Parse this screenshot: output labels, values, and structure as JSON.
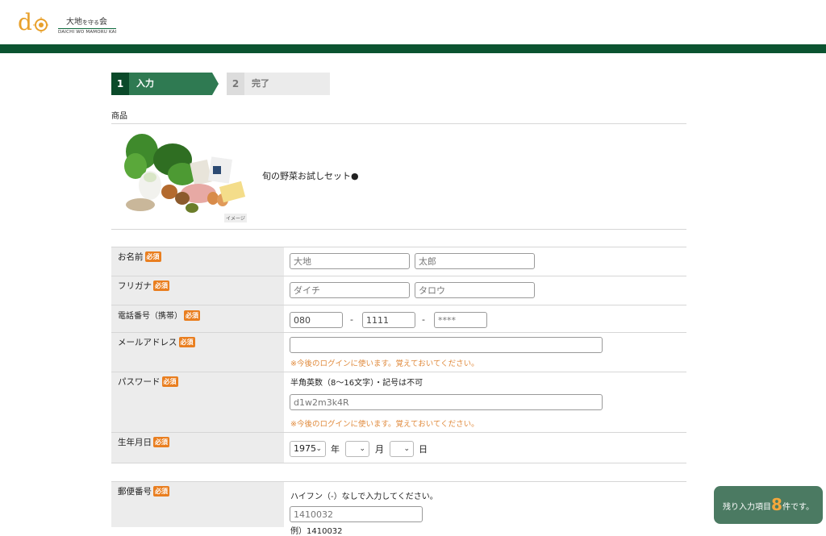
{
  "header": {
    "logo_mark": "do",
    "logo_title": "大地",
    "logo_title_small": "を守る",
    "logo_title_end": "会",
    "logo_subtitle": "DAICHI WO MAMORU KAI",
    "colors": {
      "bar": "#0b5330",
      "brand": "#e8a02b"
    }
  },
  "steps": [
    {
      "num": "1",
      "label": "入力"
    },
    {
      "num": "2",
      "label": "完了"
    }
  ],
  "product": {
    "section_label": "商品",
    "image_note": "イメージ",
    "name": "旬の野菜お試しセット●"
  },
  "form": {
    "required_badge": "必須",
    "name": {
      "label": "お名前",
      "last_placeholder": "大地",
      "first_placeholder": "太郎"
    },
    "kana": {
      "label": "フリガナ",
      "last_placeholder": "ダイチ",
      "first_placeholder": "タロウ"
    },
    "phone": {
      "label": "電話番号（携帯）",
      "part1": "080",
      "part2": "1111",
      "part3": "****",
      "dash": "-"
    },
    "email": {
      "label": "メールアドレス",
      "value": "",
      "note": "※今後のログインに使います。覚えておいてください。"
    },
    "password": {
      "label": "パスワード",
      "hint": "半角英数（8〜16文字）・記号は不可",
      "placeholder": "d1w2m3k4R",
      "note": "※今後のログインに使います。覚えておいてください。"
    },
    "birthday": {
      "label": "生年月日",
      "year": "1975",
      "year_unit": "年",
      "month": "",
      "month_unit": "月",
      "day": "",
      "day_unit": "日"
    },
    "postal": {
      "label": "郵便番号",
      "hint": "ハイフン（-）なしで入力してください。",
      "placeholder": "1410032",
      "example": "例）1410032"
    }
  },
  "remaining": {
    "prefix": "残り入力項目",
    "count": "8",
    "suffix": "件です。"
  }
}
